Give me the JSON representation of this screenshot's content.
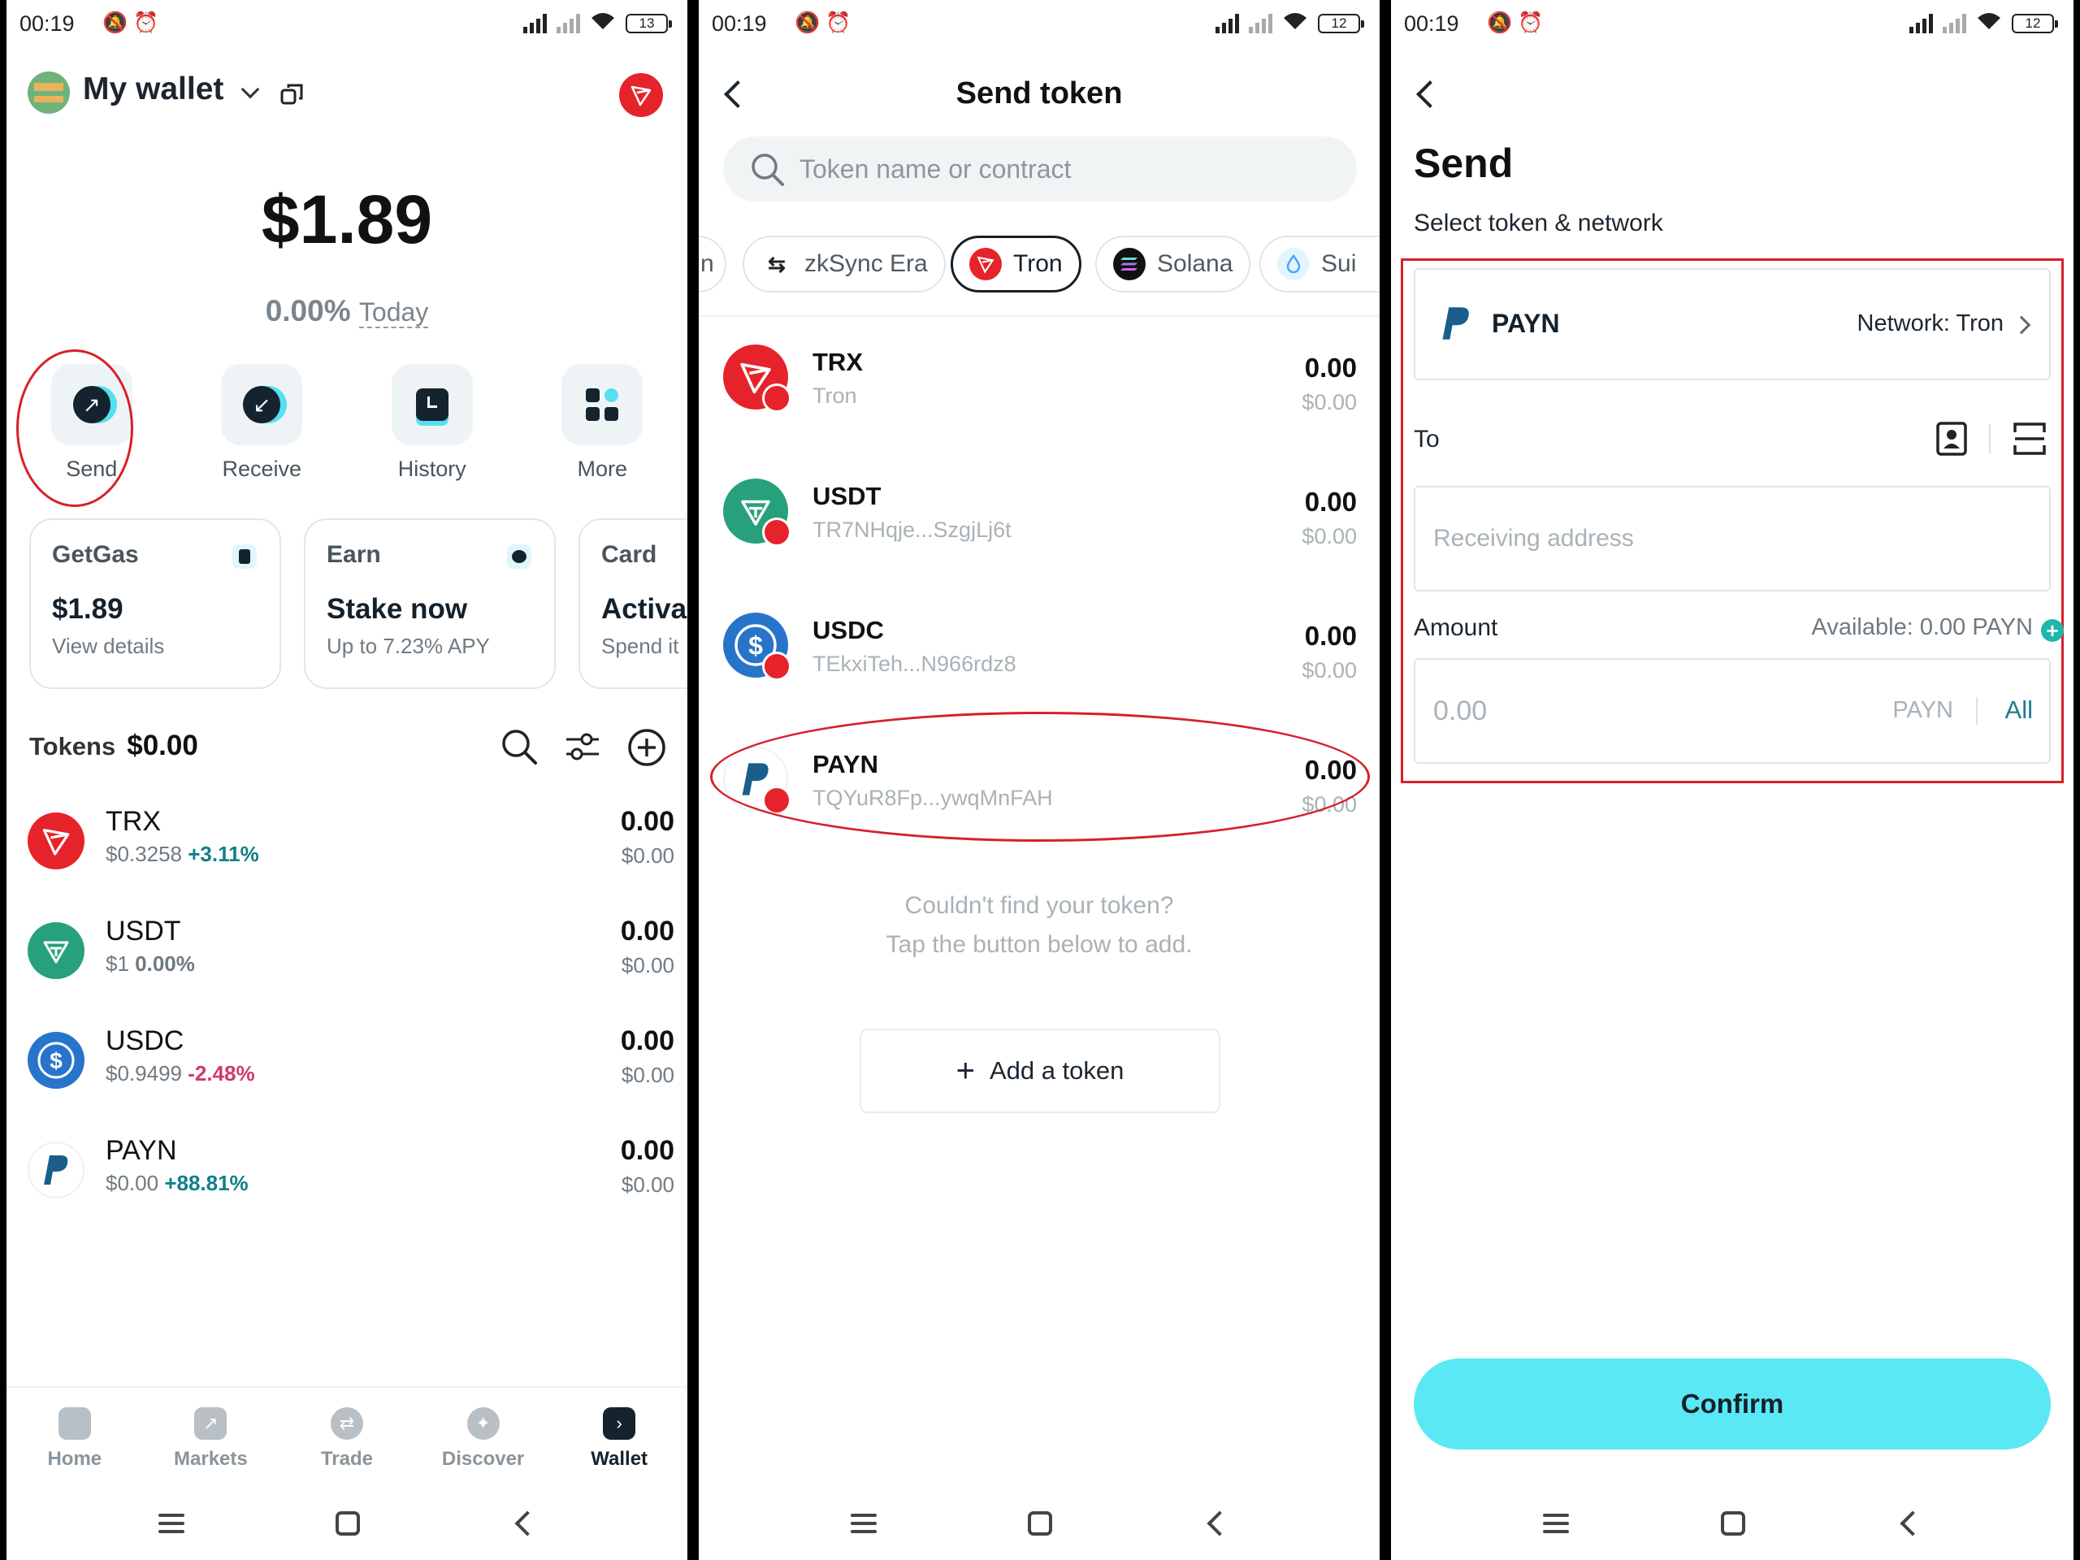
{
  "status_bars": [
    {
      "time": "00:19",
      "battery": "13"
    },
    {
      "time": "00:19",
      "battery": "12"
    },
    {
      "time": "00:19",
      "battery": "12"
    }
  ],
  "wallet": {
    "name": "My wallet",
    "balance": "$1.89",
    "change_pct": "0.00%",
    "change_period": "Today",
    "actions": [
      {
        "label": "Send",
        "icon": "arrow-up-right-icon"
      },
      {
        "label": "Receive",
        "icon": "arrow-down-left-icon"
      },
      {
        "label": "History",
        "icon": "history-icon"
      },
      {
        "label": "More",
        "icon": "grid-icon"
      }
    ],
    "cards": [
      {
        "title": "GetGas",
        "value": "$1.89",
        "sub": "View details",
        "icon": "gas-icon"
      },
      {
        "title": "Earn",
        "value": "Stake now",
        "sub": "Up to 7.23% APY",
        "icon": "piggy-bank-icon"
      },
      {
        "title": "Card",
        "value": "Activa",
        "sub": "Spend it"
      }
    ],
    "tokens_label": "Tokens",
    "tokens_total": "$0.00",
    "tokens": [
      {
        "name": "TRX",
        "price": "$0.3258",
        "change": "+3.11%",
        "trend": "pos",
        "amount": "0.00",
        "usd": "$0.00"
      },
      {
        "name": "USDT",
        "price": "$1",
        "change": "0.00%",
        "trend": "neutral",
        "amount": "0.00",
        "usd": "$0.00"
      },
      {
        "name": "USDC",
        "price": "$0.9499",
        "change": "-2.48%",
        "trend": "neg",
        "amount": "0.00",
        "usd": "$0.00"
      },
      {
        "name": "PAYN",
        "price": "$0.00",
        "change": "+88.81%",
        "trend": "pos",
        "amount": "0.00",
        "usd": "$0.00"
      }
    ],
    "tabs": [
      {
        "label": "Home",
        "active": false
      },
      {
        "label": "Markets",
        "active": false
      },
      {
        "label": "Trade",
        "active": false
      },
      {
        "label": "Discover",
        "active": false
      },
      {
        "label": "Wallet",
        "active": true
      }
    ]
  },
  "send_token": {
    "title": "Send token",
    "search_placeholder": "Token name or contract",
    "chips": [
      {
        "label": "n",
        "active": false
      },
      {
        "label": "zkSync Era",
        "active": false
      },
      {
        "label": "Tron",
        "active": true
      },
      {
        "label": "Solana",
        "active": false
      },
      {
        "label": "Sui",
        "active": false
      }
    ],
    "tokens": [
      {
        "name": "TRX",
        "addr": "Tron",
        "amount": "0.00",
        "usd": "$0.00"
      },
      {
        "name": "USDT",
        "addr": "TR7NHqje...SzgjLj6t",
        "amount": "0.00",
        "usd": "$0.00"
      },
      {
        "name": "USDC",
        "addr": "TEkxiTeh...N966rdz8",
        "amount": "0.00",
        "usd": "$0.00"
      },
      {
        "name": "PAYN",
        "addr": "TQYuR8Fp...ywqMnFAH",
        "amount": "0.00",
        "usd": "$0.00"
      }
    ],
    "not_found_line1": "Couldn't find your token?",
    "not_found_line2": "Tap the button below to add.",
    "add_button": "Add a token"
  },
  "send": {
    "title": "Send",
    "subtitle": "Select token & network",
    "token": "PAYN",
    "network": "Network: Tron",
    "to_label": "To",
    "address_placeholder": "Receiving address",
    "amount_label": "Amount",
    "available": "Available: 0.00 PAYN",
    "amount_placeholder": "0.00",
    "amount_unit": "PAYN",
    "all_label": "All",
    "confirm": "Confirm"
  },
  "colors": {
    "accent": "#5ae8f4",
    "tron_red": "#e6232a",
    "tether_green": "#26a17b",
    "usdc_blue": "#2775ca",
    "payn_blue": "#1b5e8c",
    "highlight_red": "#d6202a",
    "positive": "#10808a",
    "negative": "#d03a6a"
  }
}
